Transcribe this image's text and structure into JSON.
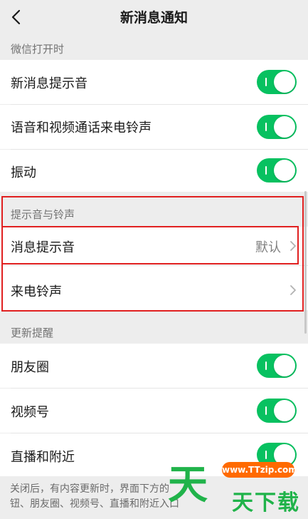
{
  "nav": {
    "title": "新消息通知"
  },
  "sections": [
    {
      "label": "微信打开时",
      "items": [
        {
          "label": "新消息提示音",
          "control": "toggle",
          "on": true
        },
        {
          "label": "语音和视频通话来电铃声",
          "control": "toggle",
          "on": true
        },
        {
          "label": "振动",
          "control": "toggle",
          "on": true
        }
      ]
    },
    {
      "label": "提示音与铃声",
      "items": [
        {
          "label": "消息提示音",
          "value": "默认",
          "control": "chevron"
        },
        {
          "label": "来电铃声",
          "control": "chevron"
        }
      ]
    },
    {
      "label": "更新提醒",
      "items": [
        {
          "label": "朋友圈",
          "control": "toggle",
          "on": true
        },
        {
          "label": "视频号",
          "control": "toggle",
          "on": true
        },
        {
          "label": "直播和附近",
          "control": "toggle",
          "on": true
        }
      ]
    }
  ],
  "footer": {
    "line1": "关闭后，有内容更新时，界面下方的",
    "line2": "钮、朋友圈、视频号、直播和附近入口"
  },
  "watermark": {
    "url": "www.TTzip.com",
    "big": "天",
    "small": "天下载"
  },
  "colors": {
    "accent": "#07c160",
    "highlight": "#e02020"
  },
  "icons": {
    "back": "chevron-left-icon",
    "chevron": "chevron-right-icon"
  }
}
